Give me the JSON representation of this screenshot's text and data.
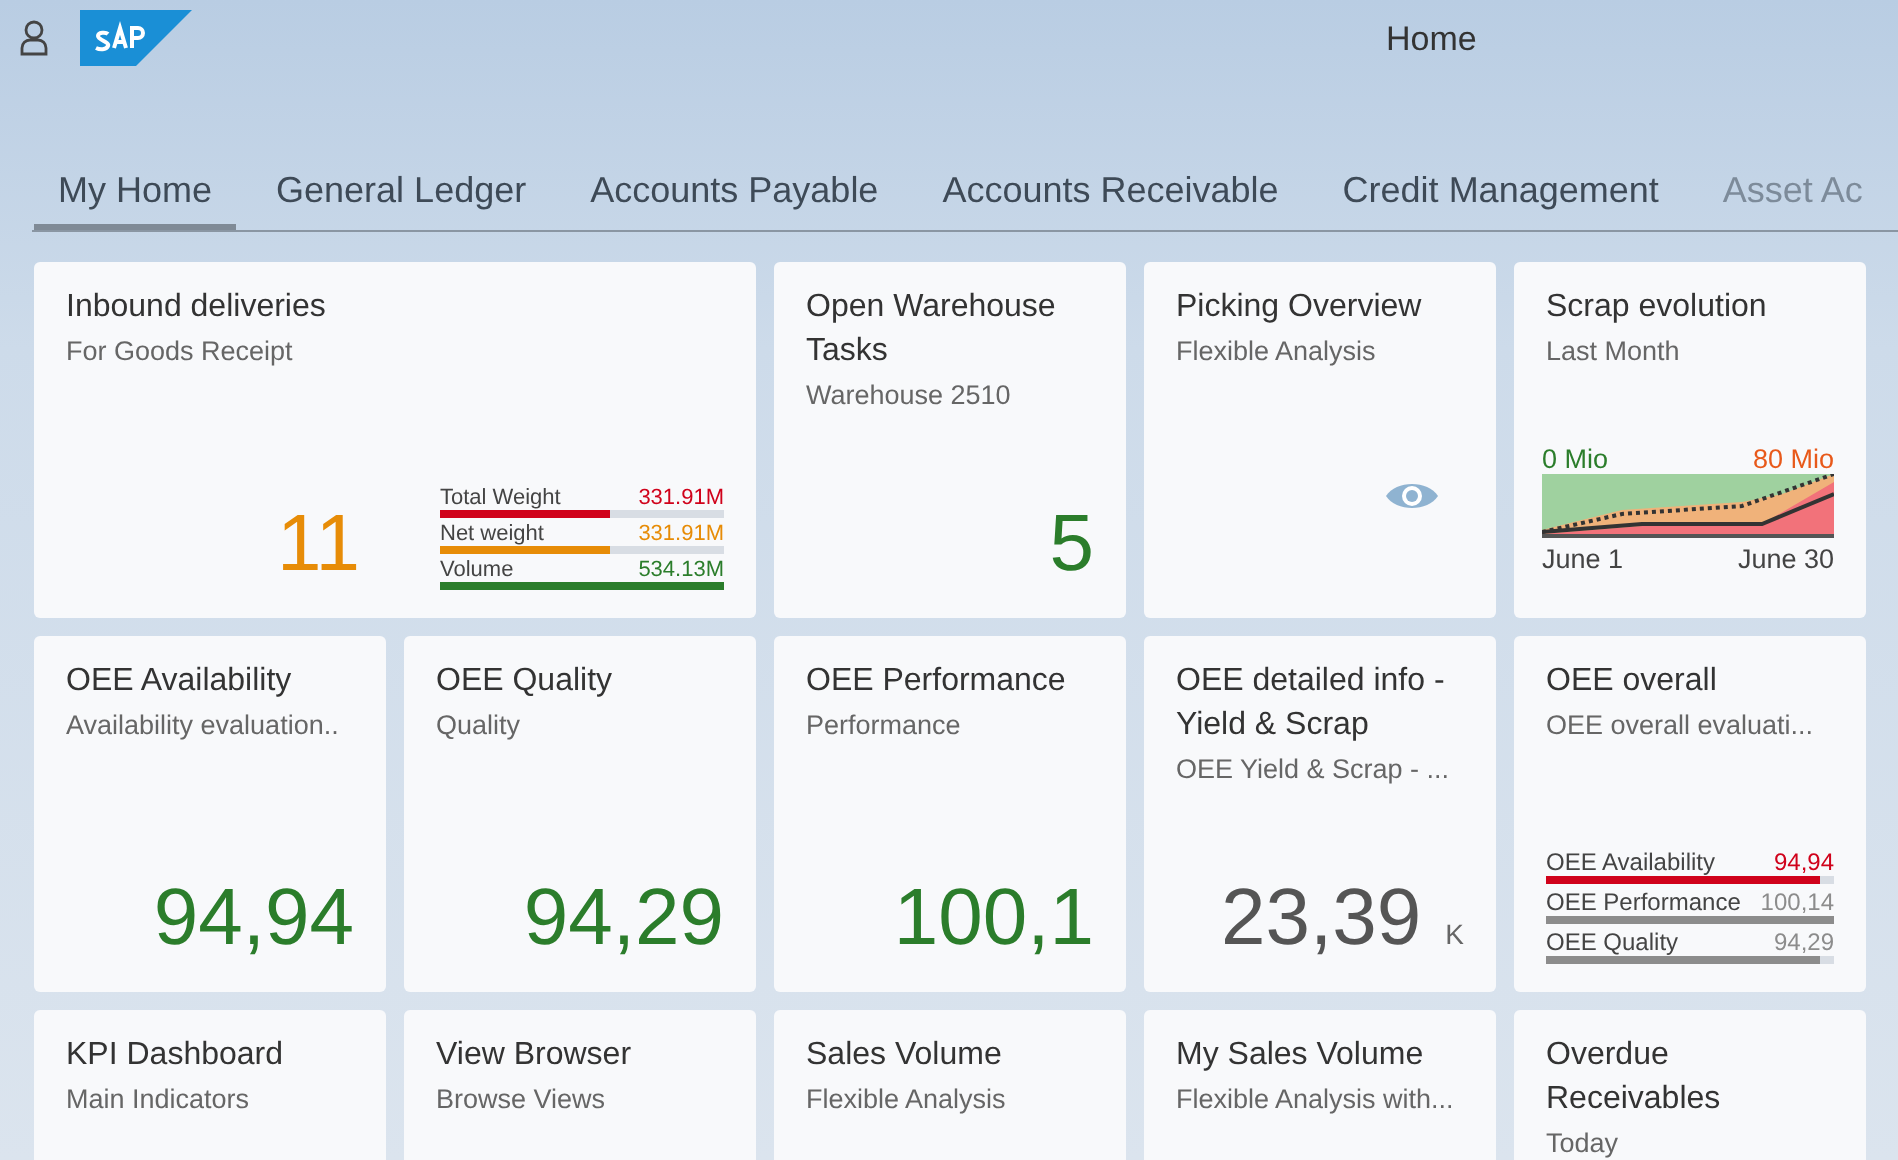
{
  "header": {
    "title": "Home"
  },
  "tabs": [
    {
      "label": "My Home",
      "selected": true
    },
    {
      "label": "General Ledger",
      "selected": false
    },
    {
      "label": "Accounts Payable",
      "selected": false
    },
    {
      "label": "Accounts Receivable",
      "selected": false
    },
    {
      "label": "Credit Management",
      "selected": false
    },
    {
      "label": "Asset Ac",
      "selected": false,
      "faded": true
    }
  ],
  "tiles": [
    {
      "kind": "numeric_comparison",
      "wide": true,
      "title": "Inbound deliveries",
      "subtitle": "For Goods Receipt",
      "value": "11",
      "color": "#e78c07",
      "rows": [
        {
          "label": "Total Weight",
          "value": "331.91M",
          "level": 0.6,
          "color": "#d0021b"
        },
        {
          "label": "Net weight",
          "value": "331.91M",
          "level": 0.6,
          "color": "#e78c07"
        },
        {
          "label": "Volume",
          "value": "534.13M",
          "level": 1,
          "color": "#2b7d2b"
        }
      ]
    },
    {
      "kind": "numeric",
      "title": "Open Warehouse Tasks",
      "subtitle": "Warehouse 2510",
      "value": "5",
      "color": "#2b7d2b"
    },
    {
      "kind": "icon",
      "title": "Picking Overview",
      "subtitle": "Flexible Analysis"
    },
    {
      "kind": "trend",
      "title": "Scrap evolution",
      "subtitle": "Last Month",
      "min_label": "0 Mio",
      "max_label": "80 Mio",
      "start_label": "June 1",
      "end_label": "June 30"
    },
    {
      "kind": "numeric",
      "title": "OEE Availability",
      "subtitle": "Availability evaluation..",
      "value": "94,94",
      "color": "#2b7d2b"
    },
    {
      "kind": "numeric",
      "title": "OEE Quality",
      "subtitle": "Quality",
      "value": "94,29",
      "color": "#2b7d2b"
    },
    {
      "kind": "numeric",
      "title": "OEE Performance",
      "subtitle": "Performance",
      "value": "100,1",
      "color": "#2b7d2b"
    },
    {
      "kind": "numeric",
      "title": "OEE detailed info - Yield & Scrap",
      "subtitle": "OEE Yield & Scrap - ...",
      "value": "23,39",
      "unit": "K",
      "color": "#555555"
    },
    {
      "kind": "comparison",
      "title": "OEE overall",
      "subtitle": "OEE overall evaluati...",
      "rows": [
        {
          "label": "OEE Availability",
          "value": "94,94",
          "level": 0.95,
          "color": "#d0021b"
        },
        {
          "label": "OEE Performance",
          "value": "100,14",
          "level": 1,
          "color": "#8c8c8c"
        },
        {
          "label": "OEE Quality",
          "value": "94,29",
          "level": 0.95,
          "color": "#8c8c8c"
        }
      ]
    },
    {
      "kind": "plain",
      "title": "KPI Dashboard",
      "subtitle": "Main Indicators"
    },
    {
      "kind": "plain",
      "title": "View Browser",
      "subtitle": "Browse Views"
    },
    {
      "kind": "plain",
      "title": "Sales Volume",
      "subtitle": "Flexible Analysis"
    },
    {
      "kind": "plain",
      "title": "My Sales Volume",
      "subtitle": "Flexible Analysis with..."
    },
    {
      "kind": "plain",
      "title": "Overdue Receivables",
      "subtitle": "Today"
    }
  ]
}
